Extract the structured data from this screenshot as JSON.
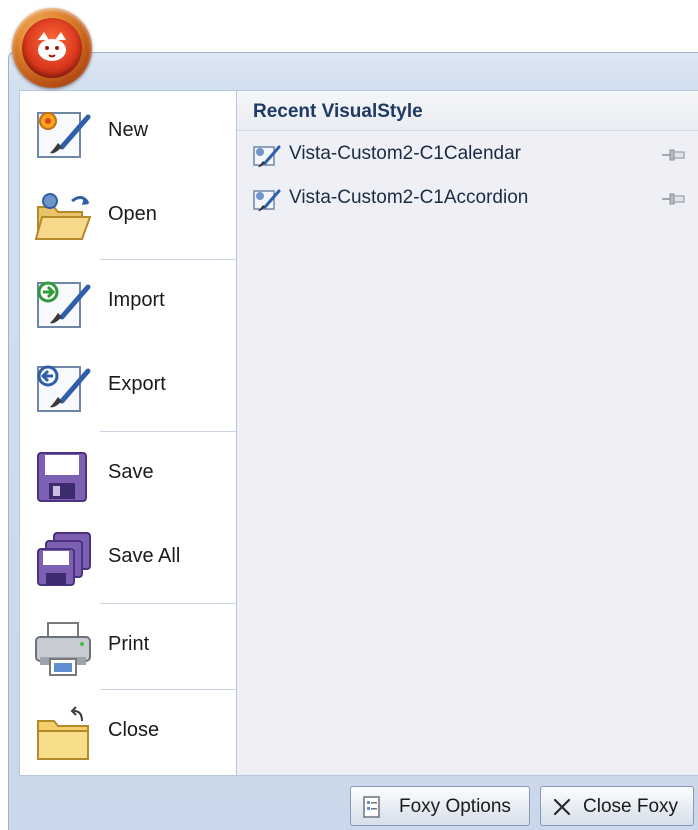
{
  "menu": {
    "items": [
      {
        "label": "New",
        "icon": "new-document-brush-icon"
      },
      {
        "label": "Open",
        "icon": "open-folder-icon"
      },
      {
        "label": "Import",
        "icon": "import-arrow-icon"
      },
      {
        "label": "Export",
        "icon": "export-arrow-icon"
      },
      {
        "label": "Save",
        "icon": "floppy-disk-icon"
      },
      {
        "label": "Save All",
        "icon": "multiple-floppy-disks-icon"
      },
      {
        "label": "Print",
        "icon": "printer-icon"
      },
      {
        "label": "Close",
        "icon": "folder-close-icon"
      }
    ]
  },
  "recent": {
    "title": "Recent VisualStyle",
    "items": [
      {
        "label": "Vista-Custom2-C1Calendar",
        "icon": "visualstyle-brush-icon"
      },
      {
        "label": "Vista-Custom2-C1Accordion",
        "icon": "visualstyle-brush-icon"
      }
    ]
  },
  "footer": {
    "options_label": "Foxy Options",
    "close_label": "Close Foxy"
  },
  "colors": {
    "frame": "#d2dfee",
    "recent_panel": "#eef0f5",
    "title_text": "#1e3a64",
    "orb": "#d7351b"
  }
}
